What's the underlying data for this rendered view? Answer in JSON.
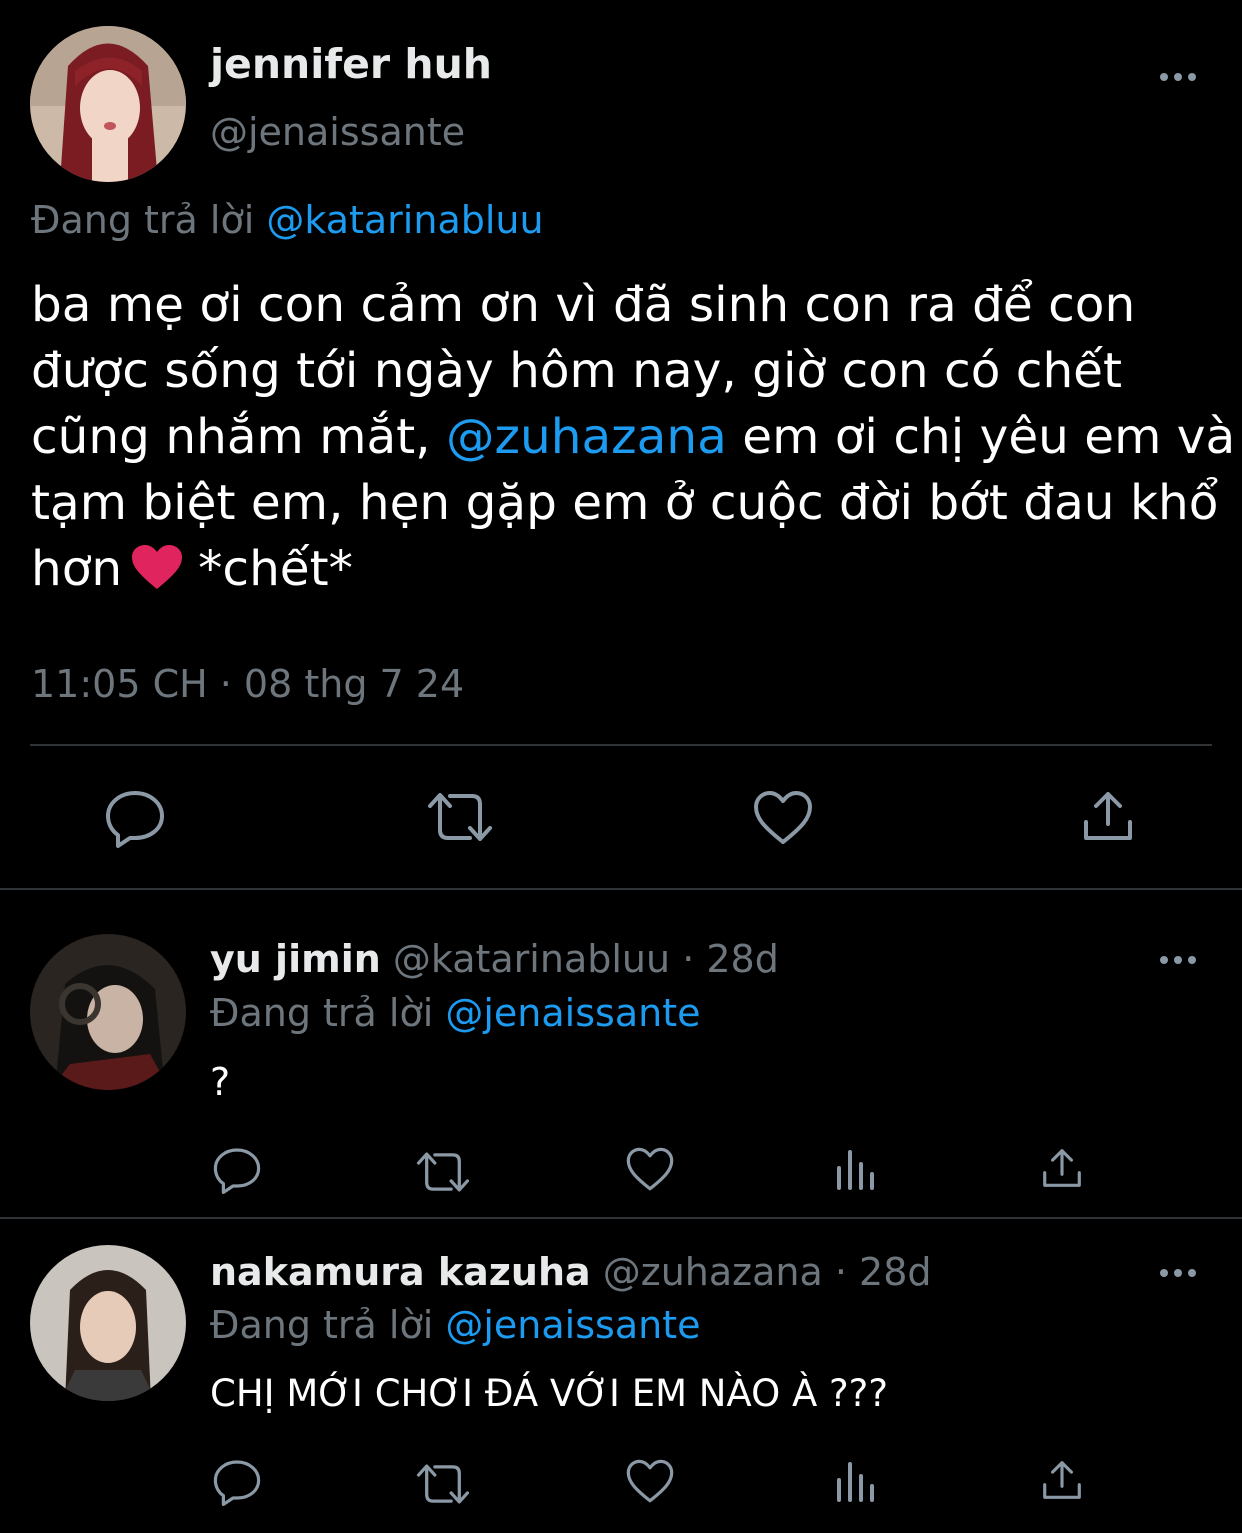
{
  "main_tweet": {
    "display_name": "jennifer huh",
    "handle": "@jenaissante",
    "replying_label": "Đang trả lời",
    "replying_to": "@katarinabluu",
    "text_part1": "ba mẹ ơi con cảm ơn vì đã sinh con ra để con được sống tới ngày hôm nay,  giờ con có chết cũng nhắm mắt,",
    "mention": "@zuhazana",
    "text_part2": "em ơi chị yêu em và tạm biệt em, hẹn gặp em ở cuộc đời bớt đau khổ hơn",
    "emoji": "❤️",
    "text_part3": "*chết*",
    "timestamp": "11:05 CH · 08 thg 7 24"
  },
  "replies": [
    {
      "display_name": "yu jimin",
      "handle": "@katarinabluu",
      "sep": "·",
      "time": "28d",
      "replying_label": "Đang trả lời",
      "replying_to": "@jenaissante",
      "text": "?"
    },
    {
      "display_name": "nakamura kazuha",
      "handle": "@zuhazana",
      "sep": "·",
      "time": "28d",
      "replying_label": "Đang trả lời",
      "replying_to": "@jenaissante",
      "text": "CHỊ MỚI CHƠI ĐÁ VỚI EM NÀO À ???"
    }
  ],
  "icons": {
    "reply": "reply-icon",
    "retweet": "retweet-icon",
    "like": "like-icon",
    "views": "views-icon",
    "share": "share-icon",
    "more": "more-icon"
  },
  "colors": {
    "background": "#000000",
    "text": "#e7e9ea",
    "secondary": "#6e767d",
    "link": "#1d9bf0",
    "divider": "#2f3336",
    "heart": "#e0245e"
  }
}
